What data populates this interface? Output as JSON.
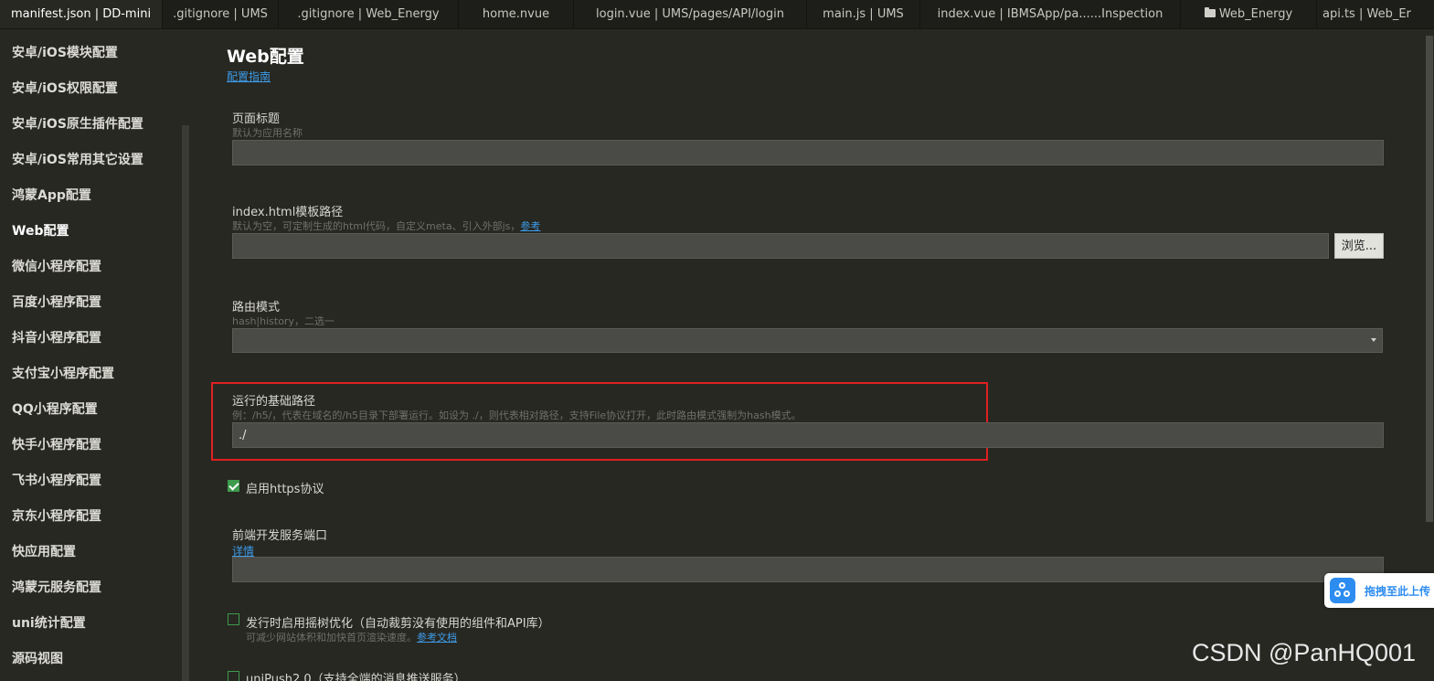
{
  "tabs": [
    {
      "label": "manifest.json | DD-mini",
      "active": true
    },
    {
      "label": ".gitignore | UMS",
      "active": false
    },
    {
      "label": ".gitignore | Web_Energy",
      "active": false
    },
    {
      "label": "home.nvue",
      "active": false
    },
    {
      "label": "login.vue | UMS/pages/API/login",
      "active": false
    },
    {
      "label": "main.js | UMS",
      "active": false
    },
    {
      "label": "index.vue | IBMSApp/pa......Inspection",
      "active": false
    },
    {
      "label": "Web_Energy",
      "active": false,
      "icon": "folder-icon"
    },
    {
      "label": "api.ts | Web_Er",
      "active": false
    }
  ],
  "sidebar": {
    "items": [
      {
        "label": "安卓/iOS模块配置"
      },
      {
        "label": "安卓/iOS权限配置"
      },
      {
        "label": "安卓/iOS原生插件配置"
      },
      {
        "label": "安卓/iOS常用其它设置"
      },
      {
        "label": "鸿蒙App配置"
      },
      {
        "label": "Web配置",
        "active": true
      },
      {
        "label": "微信小程序配置"
      },
      {
        "label": "百度小程序配置"
      },
      {
        "label": "抖音小程序配置"
      },
      {
        "label": "支付宝小程序配置"
      },
      {
        "label": "QQ小程序配置"
      },
      {
        "label": "快手小程序配置"
      },
      {
        "label": "飞书小程序配置"
      },
      {
        "label": "京东小程序配置"
      },
      {
        "label": "快应用配置"
      },
      {
        "label": "鸿蒙元服务配置"
      },
      {
        "label": "uni统计配置"
      },
      {
        "label": "源码视图"
      }
    ]
  },
  "main": {
    "title": "Web配置",
    "guide_link": "配置指南",
    "page_title_field": {
      "label": "页面标题",
      "hint": "默认为应用名称",
      "value": ""
    },
    "index_template_field": {
      "label": "index.html模板路径",
      "hint": "默认为空，可定制生成的html代码，自定义meta、引入外部js，",
      "hint_link": "参考",
      "value": "",
      "browse_label": "浏览..."
    },
    "router_mode_field": {
      "label": "路由模式",
      "hint": "hash|history，二选一",
      "value": ""
    },
    "base_path_field": {
      "label": "运行的基础路径",
      "hint": "例：/h5/，代表在域名的/h5目录下部署运行。如设为 ./，则代表相对路径，支持File协议打开，此时路由模式强制为hash模式。",
      "value": "./"
    },
    "https_checkbox": {
      "label": "启用https协议",
      "checked": true
    },
    "dev_port_field": {
      "label": "前端开发服务端口",
      "details_link": "详情",
      "value": ""
    },
    "tree_shaking_checkbox": {
      "label": "发行时启用摇树优化（自动裁剪没有使用的组件和API库）",
      "hint": "可减少网站体积和加快首页渲染速度。",
      "hint_link": "参考文档",
      "checked": false
    },
    "unipush_checkbox": {
      "label": "uniPush2.0（支持全端的消息推送服务）",
      "checked": false
    }
  },
  "upload_widget": {
    "label": "拖拽至此上传",
    "icon": "cloud-upload-icon",
    "color": "#2d8cf0"
  },
  "watermark": "CSDN @PanHQ001",
  "colors": {
    "background": "#272822",
    "tabbar": "#1d1e19",
    "input": "#4a4a46",
    "link": "#3d9be9",
    "checkbox": "#3e9a4d",
    "highlight": "#e02020"
  }
}
